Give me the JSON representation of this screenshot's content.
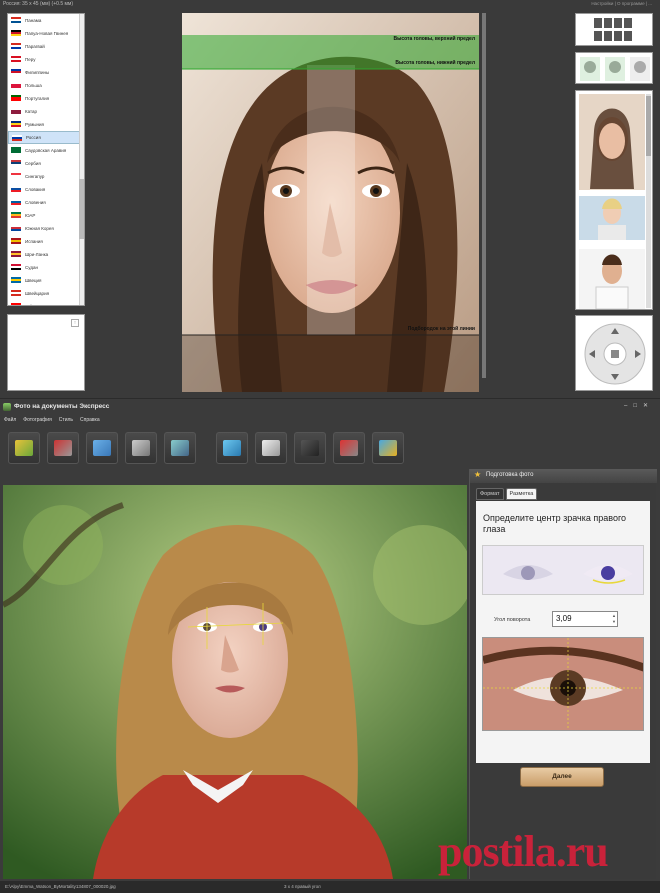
{
  "top_window": {
    "title": "Россия: 35 x 45 (мм) (+0.5 мм)",
    "right_menu": "Настройки  |  О программе  |  ...",
    "countries": [
      {
        "name": "Панама",
        "selected": false,
        "colors": [
          "#d52b1e",
          "#ffffff",
          "#005293"
        ]
      },
      {
        "name": "Папуа-Новая Гвинея",
        "selected": false,
        "colors": [
          "#000000",
          "#ce1126",
          "#fcd116"
        ]
      },
      {
        "name": "Парагвай",
        "selected": false,
        "colors": [
          "#d52b1e",
          "#ffffff",
          "#0038a8"
        ]
      },
      {
        "name": "Перу",
        "selected": false,
        "colors": [
          "#d91023",
          "#ffffff",
          "#d91023"
        ]
      },
      {
        "name": "Филиппины",
        "selected": false,
        "colors": [
          "#0038a8",
          "#ce1126",
          "#ffffff"
        ]
      },
      {
        "name": "Польша",
        "selected": false,
        "colors": [
          "#ffffff",
          "#dc143c",
          "#dc143c"
        ]
      },
      {
        "name": "Португалия",
        "selected": false,
        "colors": [
          "#006600",
          "#ff0000",
          "#ff0000"
        ]
      },
      {
        "name": "Катар",
        "selected": false,
        "colors": [
          "#ffffff",
          "#8d1b3d",
          "#8d1b3d"
        ]
      },
      {
        "name": "Румыния",
        "selected": false,
        "colors": [
          "#002b7f",
          "#fcd116",
          "#ce1126"
        ]
      },
      {
        "name": "Россия",
        "selected": true,
        "colors": [
          "#ffffff",
          "#0039a6",
          "#d52b1e"
        ]
      },
      {
        "name": "Саудовская Аравия",
        "selected": false,
        "colors": [
          "#006c35",
          "#006c35",
          "#006c35"
        ]
      },
      {
        "name": "Сербия",
        "selected": false,
        "colors": [
          "#c6363c",
          "#0c4076",
          "#ffffff"
        ]
      },
      {
        "name": "Сингапур",
        "selected": false,
        "colors": [
          "#ef3340",
          "#ffffff",
          "#ffffff"
        ]
      },
      {
        "name": "Словакия",
        "selected": false,
        "colors": [
          "#ffffff",
          "#0b4ea2",
          "#ee1c25"
        ]
      },
      {
        "name": "Словения",
        "selected": false,
        "colors": [
          "#ffffff",
          "#005da4",
          "#ed1c24"
        ]
      },
      {
        "name": "ЮАР",
        "selected": false,
        "colors": [
          "#007749",
          "#ffb81c",
          "#de3831"
        ]
      },
      {
        "name": "Южная Корея",
        "selected": false,
        "colors": [
          "#ffffff",
          "#cd2e3a",
          "#0047a0"
        ]
      },
      {
        "name": "Испания",
        "selected": false,
        "colors": [
          "#aa151b",
          "#f1bf00",
          "#aa151b"
        ]
      },
      {
        "name": "Шри-Ланка",
        "selected": false,
        "colors": [
          "#8d153a",
          "#ffbe29",
          "#8d153a"
        ]
      },
      {
        "name": "Судан",
        "selected": false,
        "colors": [
          "#d21034",
          "#ffffff",
          "#000000"
        ]
      },
      {
        "name": "Швеция",
        "selected": false,
        "colors": [
          "#006aa7",
          "#fecc00",
          "#006aa7"
        ]
      },
      {
        "name": "Швейцария",
        "selected": false,
        "colors": [
          "#d52b1e",
          "#ffffff",
          "#d52b1e"
        ]
      },
      {
        "name": "Тайвань",
        "selected": false,
        "colors": [
          "#fe0000",
          "#000095",
          "#fe0000"
        ]
      }
    ],
    "guide_labels": {
      "head_top": "Высота головы, верхний предел",
      "head_bottom": "Высота головы, нижний предел",
      "chin": "Подбородок на этой линии"
    }
  },
  "app": {
    "title": "Фото на документы Экспресс",
    "menu": [
      "Файл",
      "Фотография",
      "Стиль",
      "Справка"
    ],
    "toolbar": [
      {
        "name": "open-folder",
        "colors": [
          "#e8c23a",
          "#6aa83a"
        ]
      },
      {
        "name": "crop",
        "colors": [
          "#c33",
          "#999"
        ]
      },
      {
        "name": "id-card",
        "colors": [
          "#6ab0e8",
          "#3a78b8"
        ]
      },
      {
        "name": "print",
        "colors": [
          "#ccc",
          "#777"
        ]
      },
      {
        "name": "camera",
        "colors": [
          "#8cc",
          "#468"
        ]
      },
      {
        "name": "edit-photo",
        "colors": [
          "#6cc8f0",
          "#2a7ab0"
        ]
      },
      {
        "name": "book",
        "colors": [
          "#eee",
          "#999"
        ]
      },
      {
        "name": "video-camera",
        "colors": [
          "#555",
          "#222"
        ]
      },
      {
        "name": "box-3d",
        "colors": [
          "#d33",
          "#888"
        ]
      },
      {
        "name": "export",
        "colors": [
          "#48a8e0",
          "#e8b020"
        ]
      }
    ],
    "side_panel": {
      "header": "Подготовка фото",
      "tabs": [
        "Формат",
        "Разметка"
      ],
      "active_tab": 1,
      "instruction": "Определите центр зрачка правого глаза",
      "angle_label": "Угол поворота",
      "angle_value": "3,09",
      "next_button": "Далее"
    },
    "status": {
      "file": "E:\\Alpy\\Emma_Watson_ByMortality134807_000020.jpg",
      "mode": "3 x 4 правый угол"
    }
  },
  "watermark": "postila.ru",
  "accent_colors": {
    "guide_green": "#2ea82e",
    "guide_yellow": "#e8d83a",
    "star": "#f3c23a",
    "watermark": "#c9223a"
  }
}
